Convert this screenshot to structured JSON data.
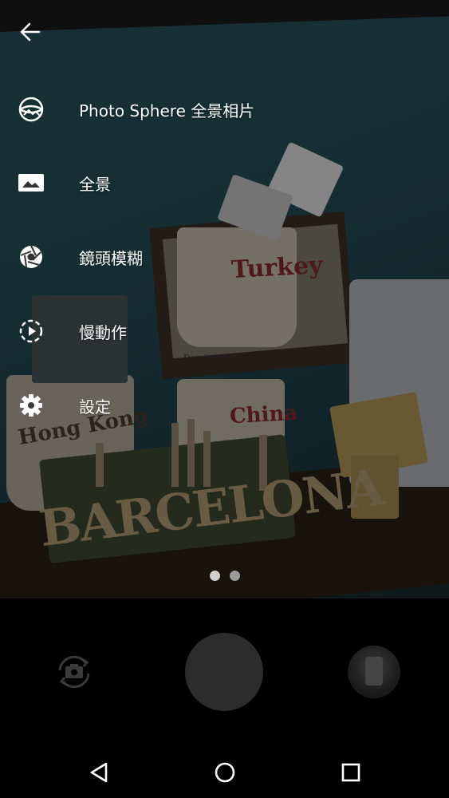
{
  "viewfinder": {
    "photo_text": {
      "mug_turkey": "Turkey",
      "mug_hong_kong": "Hong Kong",
      "mug_china": "China",
      "demitasse": "Demitasse",
      "magnet": "BARCELONA"
    }
  },
  "top": {
    "back_icon": "arrow-left-icon"
  },
  "menu": {
    "items": [
      {
        "label": "Photo Sphere 全景相片",
        "icon": "photo-sphere-icon"
      },
      {
        "label": "全景",
        "icon": "panorama-icon"
      },
      {
        "label": "鏡頭模糊",
        "icon": "lens-blur-icon"
      },
      {
        "label": "慢動作",
        "icon": "slow-motion-icon"
      },
      {
        "label": "設定",
        "icon": "settings-gear-icon"
      }
    ]
  },
  "pager": {
    "count": 2,
    "active_index": 0
  },
  "controls": {
    "switch_camera_icon": "switch-camera-icon",
    "shutter": "shutter-button",
    "thumbnail": "last-photo-thumbnail"
  },
  "navbar": {
    "back": "nav-back-icon",
    "home": "nav-home-icon",
    "recents": "nav-recents-icon"
  },
  "colors": {
    "menu_text": "#ffffff",
    "dot_active": "#d0d0d0",
    "dot_inactive": "#9a9a9a",
    "shutter": "#2c2c2c"
  }
}
